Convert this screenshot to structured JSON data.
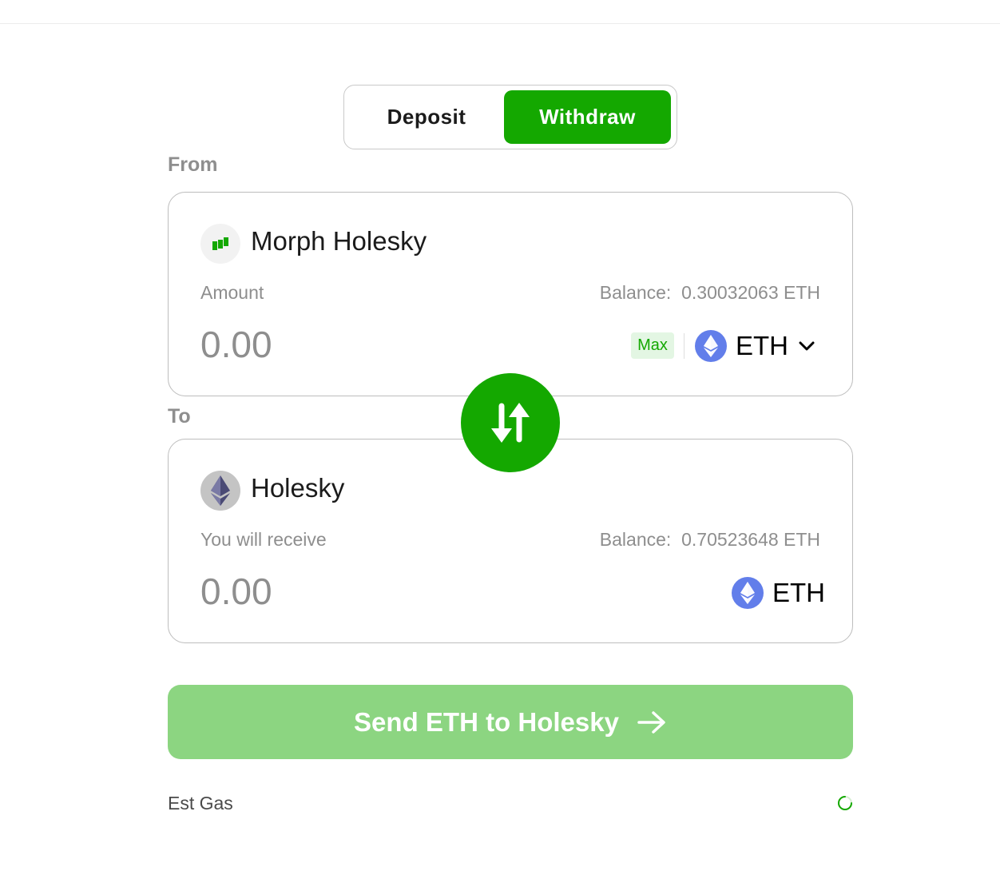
{
  "tabs": {
    "deposit_label": "Deposit",
    "withdraw_label": "Withdraw",
    "active": "Withdraw"
  },
  "from": {
    "section_label": "From",
    "network_name": "Morph Holesky",
    "network_icon": "morph-logo-icon",
    "amount_label": "Amount",
    "balance_prefix": "Balance:",
    "balance_value": "0.30032063 ETH",
    "amount_placeholder": "0.00",
    "max_label": "Max",
    "token_label": "ETH",
    "token_icon": "eth-icon"
  },
  "to": {
    "section_label": "To",
    "network_name": "Holesky",
    "network_icon": "ethereum-network-icon",
    "receive_label": "You will receive",
    "balance_prefix": "Balance:",
    "balance_value": "0.70523648 ETH",
    "amount_value": "0.00",
    "token_label": "ETH",
    "token_icon": "eth-icon"
  },
  "send_button_label": "Send ETH to Holesky",
  "gas": {
    "label": "Est Gas",
    "status_icon": "loading-spinner-icon"
  },
  "colors": {
    "accent": "#14a800",
    "accent_disabled": "#8cd581",
    "eth_blue": "#627eea",
    "muted_text": "#8e8e8e"
  }
}
